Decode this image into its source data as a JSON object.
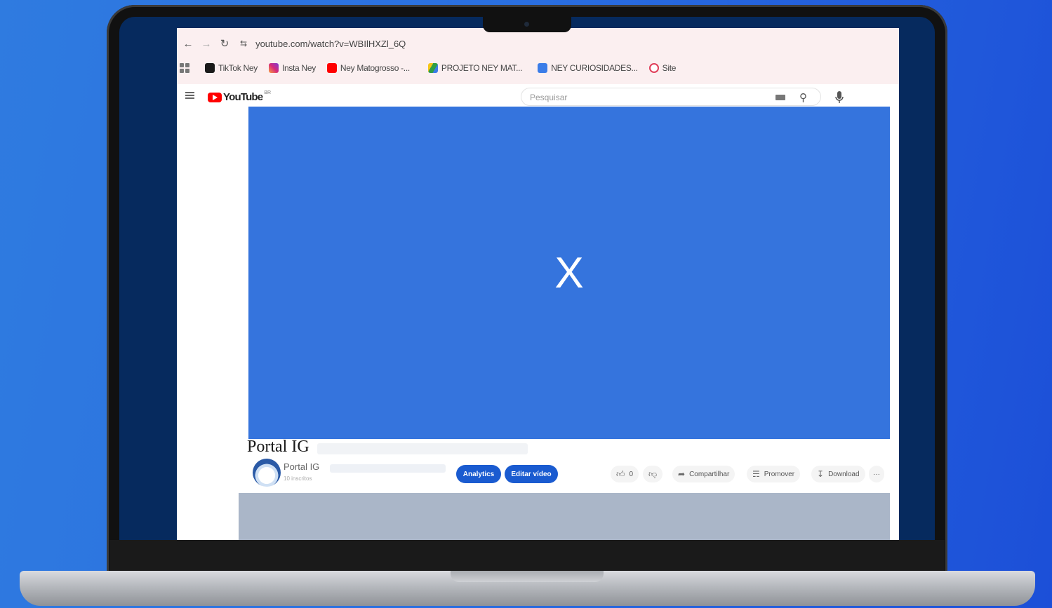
{
  "browser": {
    "nav": {
      "back_icon": "arrow-left-icon",
      "forward_icon": "arrow-right-icon",
      "reload_icon": "reload-icon",
      "site_info_icon": "tune-icon",
      "url": "youtube.com/watch?v=WBIlHXZl_6Q"
    },
    "bookmarks": [
      {
        "label": "TikTok Ney",
        "icon": "tiktok-icon",
        "color": "#1a1a1a"
      },
      {
        "label": "Insta Ney",
        "icon": "instagram-icon",
        "color": "#d6297a"
      },
      {
        "label": "Ney Matogrosso -...",
        "icon": "youtube-icon",
        "color": "#ff0000"
      },
      {
        "label": "PROJETO NEY MAT...",
        "icon": "drive-icon",
        "color": "#2f9e44"
      },
      {
        "label": "NEY CURIOSIDADES...",
        "icon": "docs-icon",
        "color": "#3b7de8"
      },
      {
        "label": "Site",
        "icon": "site-icon",
        "color": "#e0405a"
      }
    ]
  },
  "youtube": {
    "logo_text": "YouTube",
    "logo_region": "BR",
    "search_placeholder": "Pesquisar",
    "player_overlay": "X",
    "video_title": "Portal IG",
    "channel_name": "Portal IG",
    "channel_subscribers": "10 inscritos",
    "buttons": {
      "analytics": "Analytics",
      "edit_video": "Editar vídeo"
    },
    "actions": {
      "like_count": "0",
      "share": "Compartilhar",
      "promote": "Promover",
      "download": "Download",
      "more": "···"
    }
  },
  "colors": {
    "background": "#2f7be0",
    "player": "#3574dd",
    "accent_button": "#1a5bd0"
  }
}
